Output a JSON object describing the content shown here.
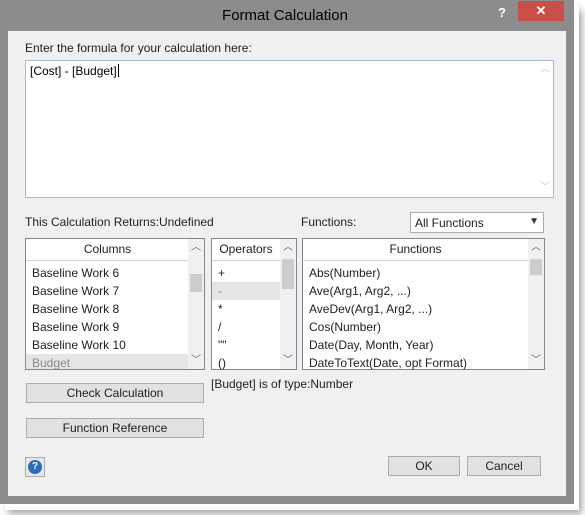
{
  "window": {
    "title": "Format Calculation",
    "help_glyph": "?",
    "close_glyph": "✕"
  },
  "formula": {
    "prompt": "Enter the formula for your calculation here:",
    "value": "[Cost] - [Budget]"
  },
  "returns": {
    "label": "This Calculation Returns:",
    "value": "Undefined"
  },
  "functions_filter": {
    "label": "Functions:",
    "selected": "All Functions"
  },
  "columns": {
    "header": "Columns",
    "items": [
      "Baseline Work 6",
      "Baseline Work 7",
      "Baseline Work 8",
      "Baseline Work 9",
      "Baseline Work 10",
      "Budget"
    ]
  },
  "operators": {
    "header": "Operators",
    "items": [
      "+",
      "-",
      "*",
      "/",
      "\"\"",
      "()"
    ]
  },
  "functions": {
    "header": "Functions",
    "items": [
      "Abs(Number)",
      "Ave(Arg1, Arg2, ...)",
      "AveDev(Arg1, Arg2, ...)",
      "Cos(Number)",
      "Date(Day, Month, Year)",
      "DateToText(Date, opt  Format)"
    ]
  },
  "type_info": "[Budget] is of type:Number",
  "buttons": {
    "check": "Check Calculation",
    "reference": "Function Reference",
    "ok": "OK",
    "cancel": "Cancel"
  },
  "colors": {
    "titlebar": "#8c8c8c",
    "close": "#c7504b",
    "client": "#f0f0f0",
    "selected_row": "#e5e5e5"
  }
}
